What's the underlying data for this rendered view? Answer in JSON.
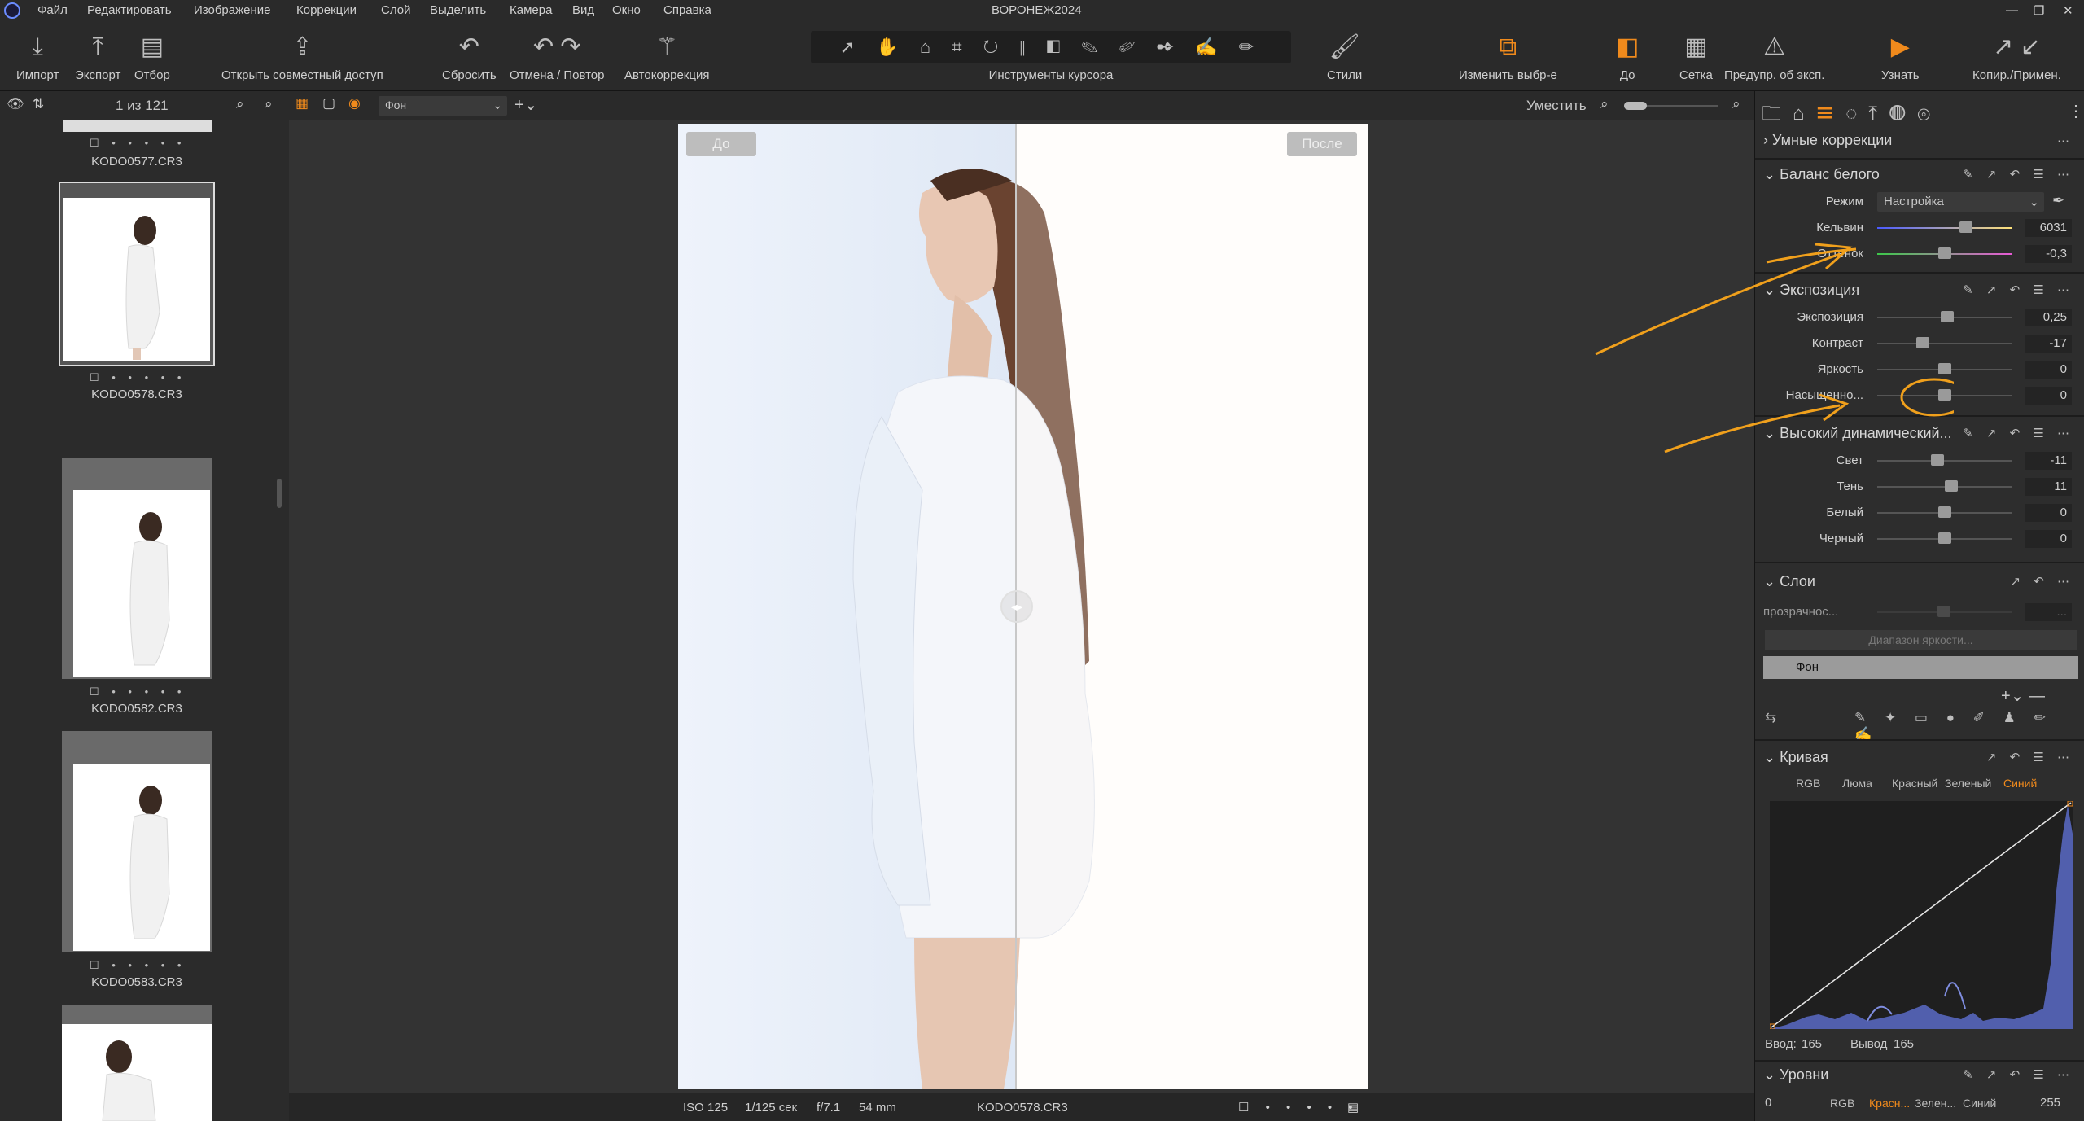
{
  "window": {
    "title": "ВОРОНЕЖ2024"
  },
  "menu": [
    "Файл",
    "Редактировать",
    "Изображение",
    "Коррекции",
    "Слой",
    "Выделить",
    "Камера",
    "Вид",
    "Окно",
    "Справка"
  ],
  "toolbar": {
    "import": "Импорт",
    "export": "Экспорт",
    "select": "Отбор",
    "share": "Открыть совместный доступ",
    "reset": "Сбросить",
    "undo_redo": "Отмена / Повтор",
    "auto": "Автокоррекция",
    "cursor_tools": "Инструменты курсора",
    "styles": "Стили",
    "edit_selection": "Изменить выбр-е",
    "before": "До",
    "grid": "Сетка",
    "exposure_warning": "Предупр. об эксп.",
    "learn": "Узнать",
    "copy_apply": "Копир./Примен."
  },
  "bar2": {
    "counter": "1 из 121",
    "layer_select": "Фон",
    "fit": "Уместить"
  },
  "filmstrip": {
    "items": [
      {
        "name": "KODO0577.CR3"
      },
      {
        "name": "KODO0578.CR3"
      },
      {
        "name": "KODO0582.CR3"
      },
      {
        "name": "KODO0583.CR3"
      }
    ]
  },
  "viewer": {
    "before_label": "До",
    "after_label": "После",
    "split_fraction": 0.49
  },
  "infobar": {
    "iso": "ISO 125",
    "shutter": "1/125 сек",
    "aperture": "f/7.1",
    "focal": "54 mm",
    "filename": "KODO0578.CR3"
  },
  "panel": {
    "smart": "Умные коррекции",
    "wb": {
      "title": "Баланс белого",
      "mode_label": "Режим",
      "mode_value": "Настройка",
      "sliders": [
        {
          "label": "Кельвин",
          "value": "6031",
          "pos": 0.66
        },
        {
          "label": "Оттенок",
          "value": "-0,3",
          "pos": 0.5
        }
      ]
    },
    "exposure": {
      "title": "Экспозиция",
      "sliders": [
        {
          "label": "Экспозиция",
          "value": "0,25",
          "pos": 0.52
        },
        {
          "label": "Контраст",
          "value": "-17",
          "pos": 0.34
        },
        {
          "label": "Яркость",
          "value": "0",
          "pos": 0.5
        },
        {
          "label": "Насыщенно...",
          "value": "0",
          "pos": 0.5
        }
      ]
    },
    "hdr": {
      "title": "Высокий динамический...",
      "sliders": [
        {
          "label": "Свет",
          "value": "-11",
          "pos": 0.45
        },
        {
          "label": "Тень",
          "value": "11",
          "pos": 0.55
        },
        {
          "label": "Белый",
          "value": "0",
          "pos": 0.5
        },
        {
          "label": "Черный",
          "value": "0",
          "pos": 0.5
        }
      ]
    },
    "layers": {
      "title": "Слои",
      "opacity_label": "прозрачнос...",
      "opacity_value": "...",
      "luma_button": "Диапазон яркости...",
      "layer_name": "Фон"
    },
    "curve": {
      "title": "Кривая",
      "tabs": [
        "RGB",
        "Люма",
        "Красный",
        "Зеленый",
        "Синий"
      ],
      "active_tab": "Синий",
      "input_label": "Ввод:",
      "input_value": "165",
      "output_label": "Вывод",
      "output_value": "165"
    },
    "levels": {
      "title": "Уровни",
      "min": "0",
      "max": "255",
      "tabs": [
        "RGB",
        "Красн...",
        "Зелен...",
        "Синий"
      ],
      "active_tab": "Красн..."
    }
  },
  "colors": {
    "accent": "#f08a1c",
    "bg": "#2a2a2a",
    "panel": "#2d2d2d",
    "viewer": "#333333"
  }
}
